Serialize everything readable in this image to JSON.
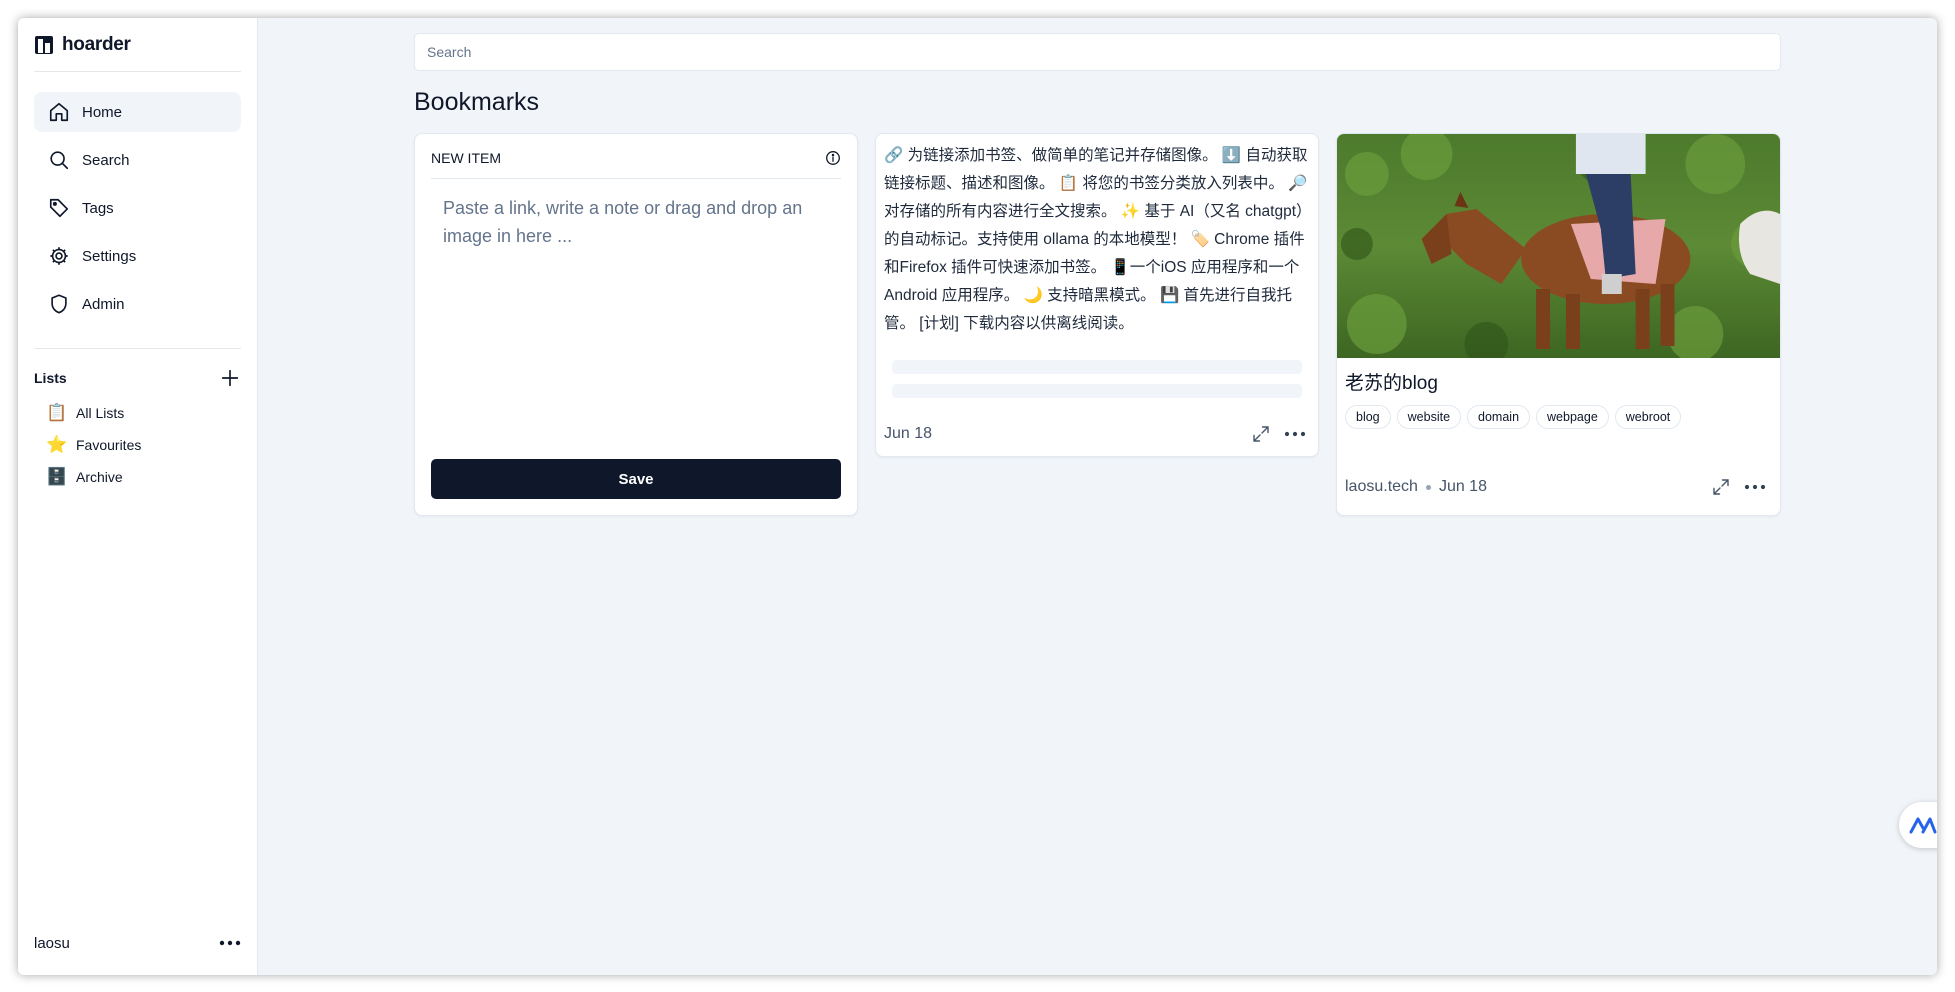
{
  "app": {
    "name": "hoarder"
  },
  "sidebar": {
    "nav": [
      {
        "label": "Home",
        "icon": "home-icon",
        "active": true
      },
      {
        "label": "Search",
        "icon": "search-icon"
      },
      {
        "label": "Tags",
        "icon": "tag-icon"
      },
      {
        "label": "Settings",
        "icon": "gear-icon"
      },
      {
        "label": "Admin",
        "icon": "shield-icon"
      }
    ],
    "lists_title": "Lists",
    "lists": [
      {
        "emoji": "📋",
        "label": "All Lists"
      },
      {
        "emoji": "⭐",
        "label": "Favourites"
      },
      {
        "emoji": "🗄️",
        "label": "Archive"
      }
    ],
    "user": "laosu"
  },
  "search": {
    "placeholder": "Search"
  },
  "page_title": "Bookmarks",
  "new_item": {
    "title": "NEW ITEM",
    "placeholder": "Paste a link, write a note or drag and drop an image in here ...",
    "save_label": "Save"
  },
  "text_card": {
    "body": "🔗 为链接添加书签、做简单的笔记并存储图像。 ⬇️ 自动获取链接标题、描述和图像。 📋 将您的书签分类放入列表中。 🔎 对存储的所有内容进行全文搜索。 ✨ 基于 AI（又名 chatgpt）的自动标记。支持使用 ollama 的本地模型！ 🏷️ Chrome 插件和Firefox 插件可快速添加书签。 📱一个iOS 应用程序和一个Android 应用程序。 🌙 支持暗黑模式。 💾 首先进行自我托管。 [计划] 下载内容以供离线阅读。",
    "date": "Jun 18"
  },
  "link_card": {
    "title": "老苏的blog",
    "tags": [
      "blog",
      "website",
      "domain",
      "webpage",
      "webroot"
    ],
    "domain": "laosu.tech",
    "date": "Jun 18"
  },
  "colors": {
    "primary": "#0f172a",
    "background": "#f1f5f9",
    "accent_float": "#2563eb"
  }
}
